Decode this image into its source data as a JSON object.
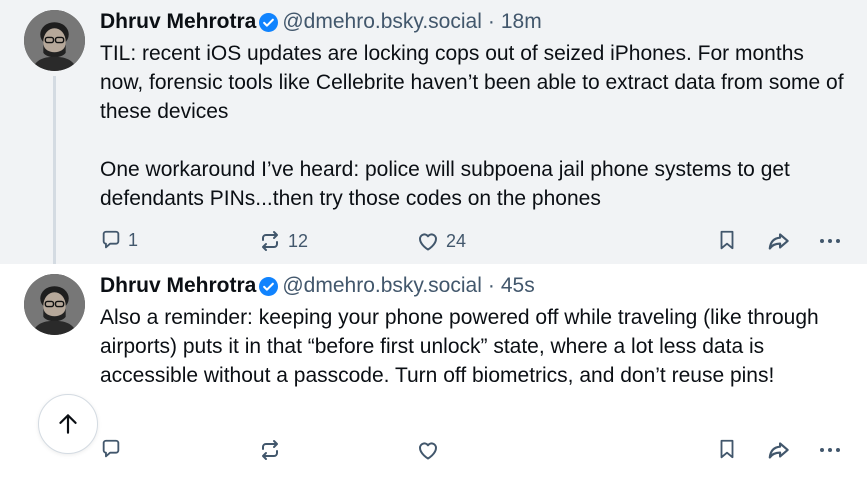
{
  "posts": [
    {
      "author_name": "Dhruv Mehrotra",
      "handle": "@dmehro.bsky.social",
      "separator": "·",
      "time": "18m",
      "paragraphs": [
        "TIL: recent iOS updates are locking cops out of seized iPhones. For months now, forensic tools like Cellebrite haven’t been able to extract data from some of these devices",
        "One workaround I’ve heard: police will subpoena jail phone systems to get defendants PINs...then try those codes on the phones"
      ],
      "reply_count": "1",
      "repost_count": "12",
      "like_count": "24"
    },
    {
      "author_name": "Dhruv Mehrotra",
      "handle": "@dmehro.bsky.social",
      "separator": "·",
      "time": "45s",
      "paragraphs": [
        "Also a reminder: keeping your phone powered off while traveling (like through airports) puts it in that “before first unlock” state, where a lot less data is accessible without a passcode. Turn off biometrics, and don’t reuse pins!"
      ],
      "reply_count": "",
      "repost_count": "",
      "like_count": ""
    }
  ],
  "colors": {
    "accent": "#1083fe",
    "muted_text": "#42576c",
    "thread_line": "#d4dbe2",
    "highlight_bg": "#f1f3f5"
  },
  "icons": [
    "avatar-photo",
    "verified-badge-icon",
    "reply-icon",
    "repost-icon",
    "heart-icon",
    "bookmark-icon",
    "share-icon",
    "more-icon",
    "arrow-up-icon"
  ]
}
